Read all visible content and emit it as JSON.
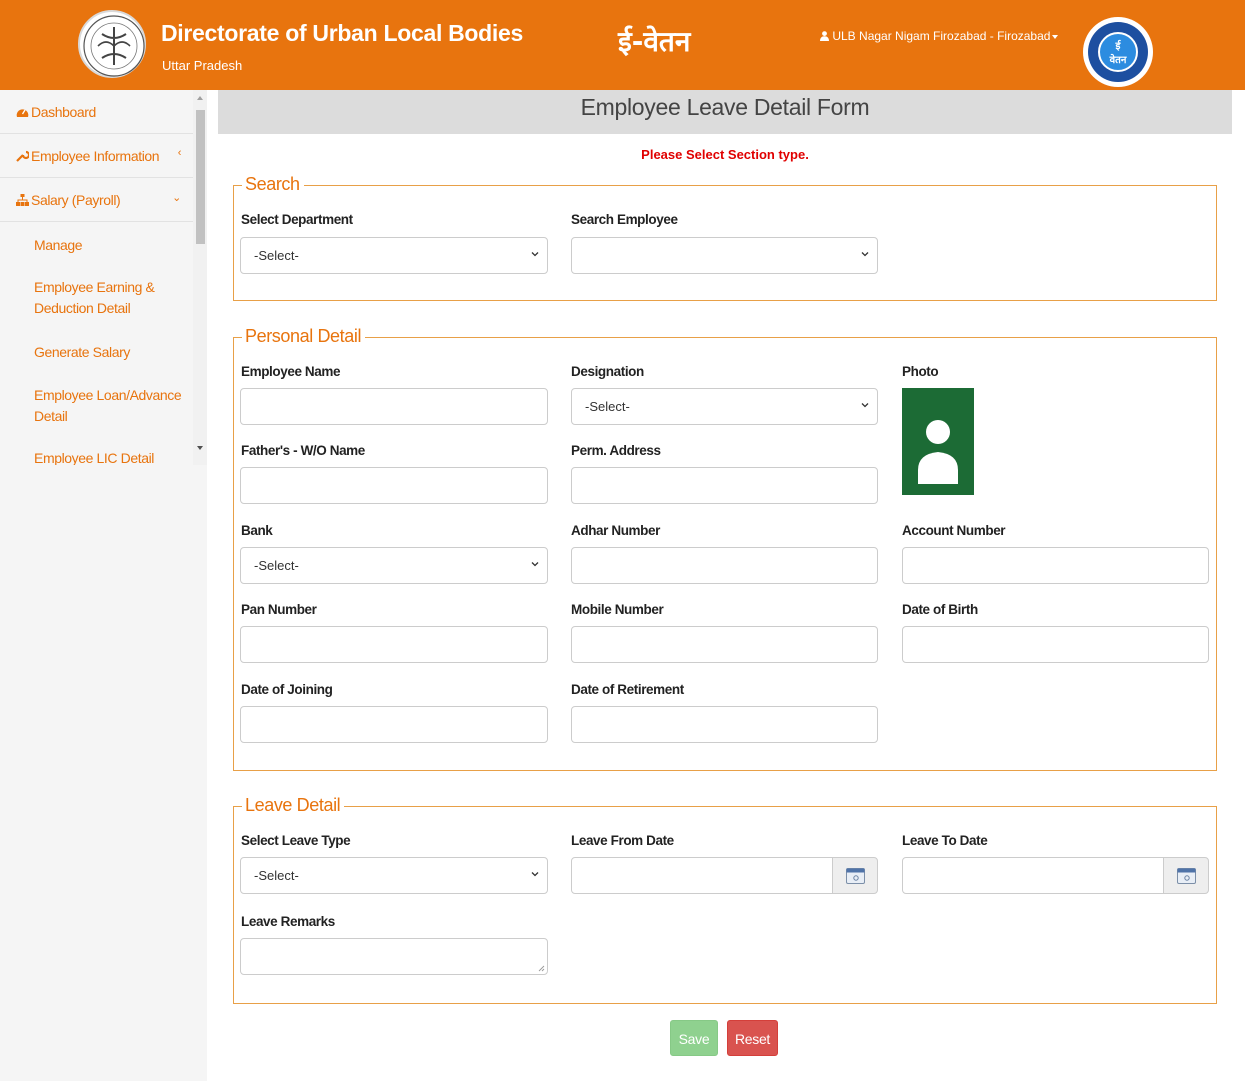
{
  "header": {
    "title": "Directorate of Urban Local Bodies",
    "subtitle": "Uttar Pradesh",
    "app_name": "ई-वेतन",
    "user_label": "ULB Nagar Nigam Firozabad - Firozabad",
    "right_logo_text": "ई\nवेतन",
    "brand_color": "#e8740e"
  },
  "sidebar": {
    "items": [
      {
        "label": "Dashboard",
        "icon": "dashboard-icon"
      },
      {
        "label": "Employee Information",
        "icon": "wrench-icon",
        "chevron": "‹"
      },
      {
        "label": "Salary (Payroll)",
        "icon": "sitemap-icon",
        "chevron": "⌄"
      }
    ],
    "subitems": [
      "Manage",
      "Employee Earning & Deduction Detail",
      "Generate Salary",
      "Employee Loan/Advance Detail",
      "Employee LIC Detail"
    ]
  },
  "page": {
    "title": "Employee Leave Detail Form",
    "warning": "Please Select Section type."
  },
  "search": {
    "legend": "Search",
    "department_label": "Select Department",
    "department_value": "-Select-",
    "employee_label": "Search Employee",
    "employee_value": ""
  },
  "personal": {
    "legend": "Personal Detail",
    "employee_name_label": "Employee Name",
    "designation_label": "Designation",
    "designation_value": "-Select-",
    "photo_label": "Photo",
    "father_label": "Father's - W/O Name",
    "address_label": "Perm. Address",
    "bank_label": "Bank",
    "bank_value": "-Select-",
    "adhar_label": "Adhar Number",
    "account_label": "Account Number",
    "pan_label": "Pan Number",
    "mobile_label": "Mobile Number",
    "dob_label": "Date of Birth",
    "doj_label": "Date of Joining",
    "dor_label": "Date of Retirement"
  },
  "leave": {
    "legend": "Leave Detail",
    "type_label": "Select Leave Type",
    "type_value": "-Select-",
    "from_label": "Leave From Date",
    "to_label": "Leave To Date",
    "remarks_label": "Leave Remarks"
  },
  "buttons": {
    "save": "Save",
    "reset": "Reset",
    "save_color": "#8fd18f",
    "reset_color": "#d9534f"
  }
}
